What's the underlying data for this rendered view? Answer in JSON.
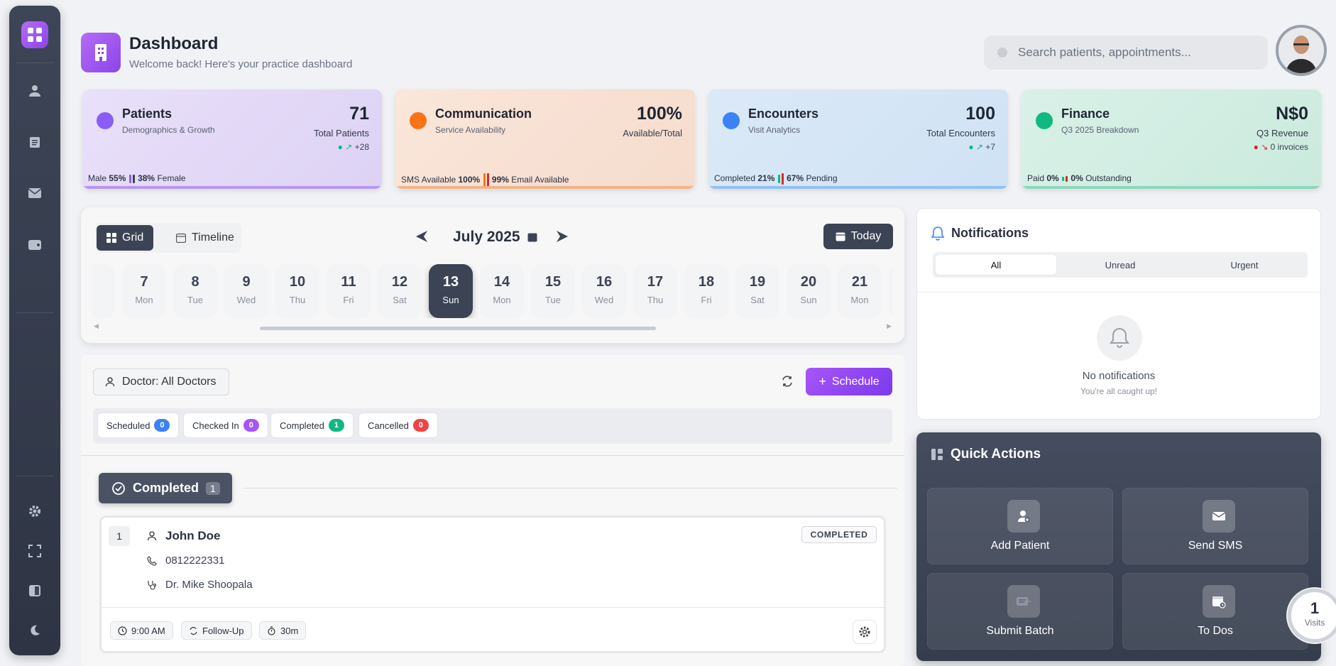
{
  "header": {
    "title": "Dashboard",
    "subtitle": "Welcome back! Here's your practice dashboard",
    "search_placeholder": "Search patients, appointments..."
  },
  "colors": {
    "accent_purple": "#8b45e8",
    "dark_slate": "#3b4354",
    "patients_card": "#e6dcf7",
    "communication_card": "#f8e2d4",
    "encounters_card": "#d7e7f6",
    "finance_card": "#d6efe6"
  },
  "stats": {
    "patients": {
      "title": "Patients",
      "subtitle": "Demographics & Growth",
      "value": "71",
      "label": "Total Patients",
      "trend": "+28",
      "foot_a_label": "Male",
      "foot_a_value": "55%",
      "foot_b_value": "38%",
      "foot_b_label": "Female"
    },
    "communication": {
      "title": "Communication",
      "subtitle": "Service Availability",
      "value": "100%",
      "label": "Available/Total",
      "foot_a_label": "SMS Available",
      "foot_a_value": "100%",
      "foot_b_value": "99%",
      "foot_b_label": "Email Available"
    },
    "encounters": {
      "title": "Encounters",
      "subtitle": "Visit Analytics",
      "value": "100",
      "label": "Total Encounters",
      "trend": "+7",
      "foot_a_label": "Completed",
      "foot_a_value": "21%",
      "foot_b_value": "67%",
      "foot_b_label": "Pending"
    },
    "finance": {
      "title": "Finance",
      "subtitle": "Q3 2025 Breakdown",
      "value": "N$0",
      "label": "Q3 Revenue",
      "trend": "0 invoices",
      "foot_a_label": "Paid",
      "foot_a_value": "0%",
      "foot_b_value": "0%",
      "foot_b_label": "Outstanding"
    }
  },
  "calendar": {
    "view_grid": "Grid",
    "view_timeline": "Timeline",
    "month": "July 2025",
    "today": "Today",
    "days": [
      {
        "n": "7",
        "w": "Mon"
      },
      {
        "n": "8",
        "w": "Tue"
      },
      {
        "n": "9",
        "w": "Wed"
      },
      {
        "n": "10",
        "w": "Thu"
      },
      {
        "n": "11",
        "w": "Fri"
      },
      {
        "n": "12",
        "w": "Sat"
      },
      {
        "n": "13",
        "w": "Sun"
      },
      {
        "n": "14",
        "w": "Mon"
      },
      {
        "n": "15",
        "w": "Tue"
      },
      {
        "n": "16",
        "w": "Wed"
      },
      {
        "n": "17",
        "w": "Thu"
      },
      {
        "n": "18",
        "w": "Fri"
      },
      {
        "n": "19",
        "w": "Sat"
      },
      {
        "n": "20",
        "w": "Sun"
      },
      {
        "n": "21",
        "w": "Mon"
      }
    ]
  },
  "appointments": {
    "doctor_filter": "Doctor: All Doctors",
    "schedule": "Schedule",
    "status": {
      "scheduled": {
        "label": "Scheduled",
        "count": "0"
      },
      "checked_in": {
        "label": "Checked In",
        "count": "0"
      },
      "completed": {
        "label": "Completed",
        "count": "1"
      },
      "cancelled": {
        "label": "Cancelled",
        "count": "0"
      }
    },
    "section": {
      "label": "Completed",
      "count": "1"
    },
    "item": {
      "index": "1",
      "name": "John Doe",
      "phone": "0812222331",
      "doctor": "Dr. Mike Shoopala",
      "status": "COMPLETED",
      "time": "9:00 AM",
      "type": "Follow-Up",
      "duration": "30m"
    }
  },
  "notifications": {
    "title": "Notifications",
    "tabs": [
      "All",
      "Unread",
      "Urgent"
    ],
    "empty_title": "No notifications",
    "empty_sub": "You're all caught up!"
  },
  "quick_actions": {
    "title": "Quick Actions",
    "add_patient": "Add Patient",
    "send_sms": "Send SMS",
    "submit_batch": "Submit Batch",
    "to_dos": "To Dos"
  },
  "visits": {
    "count": "1",
    "label": "Visits"
  }
}
